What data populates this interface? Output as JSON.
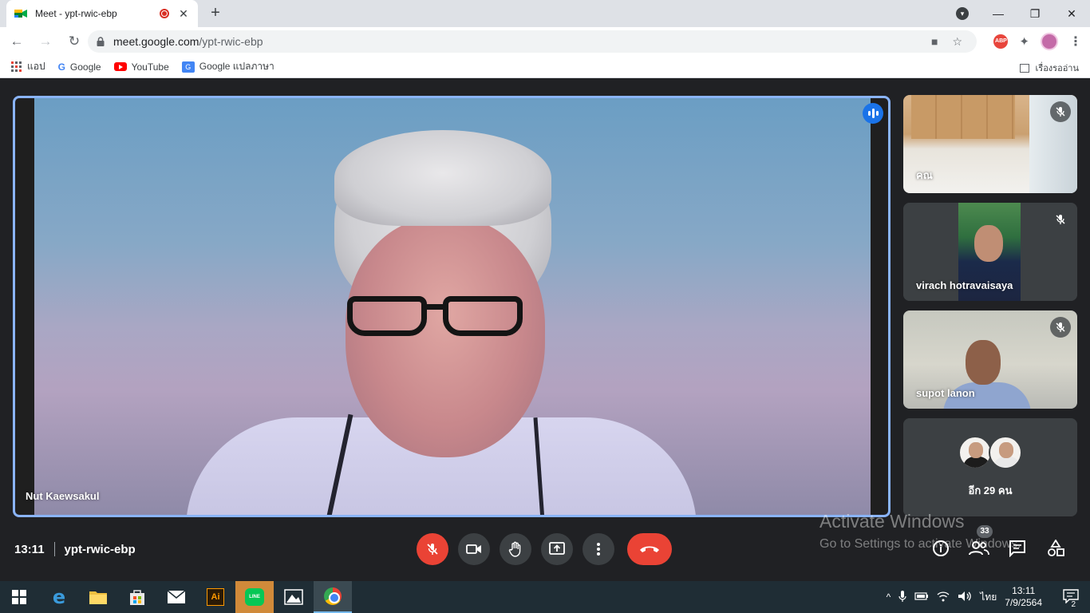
{
  "browser": {
    "tab_title": "Meet - ypt-rwic-ebp",
    "tab_close": "✕",
    "new_tab": "+",
    "window_controls": [
      "—",
      "❐",
      "✕"
    ],
    "url_host": "meet.google.com",
    "url_path": "/ypt-rwic-ebp",
    "abp_label": "ABP",
    "bookmarks": [
      {
        "label": "แอป",
        "icon": "apps-grid-icon"
      },
      {
        "label": "Google",
        "icon": "google-icon"
      },
      {
        "label": "YouTube",
        "icon": "youtube-icon"
      },
      {
        "label": "Google แปลภาษา",
        "icon": "translate-icon"
      }
    ],
    "reading_list": "เรื่องรออ่าน"
  },
  "meet": {
    "main_participant": "Nut Kaewsakul",
    "side_tiles": [
      {
        "name": "คณ",
        "muted": true
      },
      {
        "name": "virach hotravaisaya",
        "muted": true
      },
      {
        "name": "supot lanon",
        "muted": true
      }
    ],
    "others_label": "อีก 29 คน",
    "time": "13:11",
    "meeting_code": "ypt-rwic-ebp",
    "participant_count": "33",
    "accent_color": "#8ab4f8",
    "end_call_color": "#ea4335"
  },
  "windows": {
    "watermark_title": "Activate Windows",
    "watermark_sub": "Go to Settings to activate Windows.",
    "clock_time": "13:11",
    "clock_date": "7/9/2564",
    "lang": "ไทย",
    "notifications": "2",
    "ai_label": "Ai",
    "line_label": "LINE"
  }
}
